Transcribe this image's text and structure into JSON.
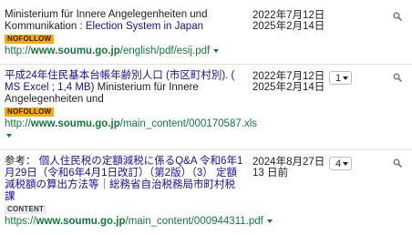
{
  "results": [
    {
      "title_plain": "Ministerium für Innere Angelegenheiten und Kommunikation : ",
      "title_link": "Election System in Japan",
      "badge": "NOFOLLOW",
      "url_domain": "http://www.soumu.go.jp",
      "url_path": "/english/pdf/esij.pdf",
      "date_line1": "2022年7月12日",
      "date_line2": "2025年2月14日",
      "select_value": ""
    },
    {
      "title_link": "平成24年住民基本台帳年齢別人口 (市区町村別). ( MS Excel ; 1,4 MB)",
      "title_plain": " Ministerium für Innere Angelegenheiten und",
      "badge": "NOFOLLOW",
      "url_domain": "http://www.soumu.go.jp",
      "url_path": "/main_content/000170587.xls",
      "date_line1": "2022年7月12日",
      "date_line2": "2025年2月14日",
      "select_value": "1"
    },
    {
      "title_plain": "参考： ",
      "title_link": "個人住民税の定額減税に係るQ&A 令和6年1月29日（令和6年4月1日改訂）（第2版）（3） 定額減税額の算出方法等｜総務省自治税務局市町村税課",
      "badge": "CONTENT",
      "url_domain": "https://www.soumu.go.jp",
      "url_path": "/main_content/000944311.pdf",
      "date_line1": "2024年8月27日",
      "date_line2": "13 日前",
      "select_value": "4"
    }
  ],
  "icons": {
    "action": "search-icon",
    "dropdown": "chevron-down-icon"
  },
  "colors": {
    "link": "#1a0dab",
    "url": "#0f7a3c",
    "nofollow": "#f9ab00",
    "content": "#e8eaed"
  }
}
